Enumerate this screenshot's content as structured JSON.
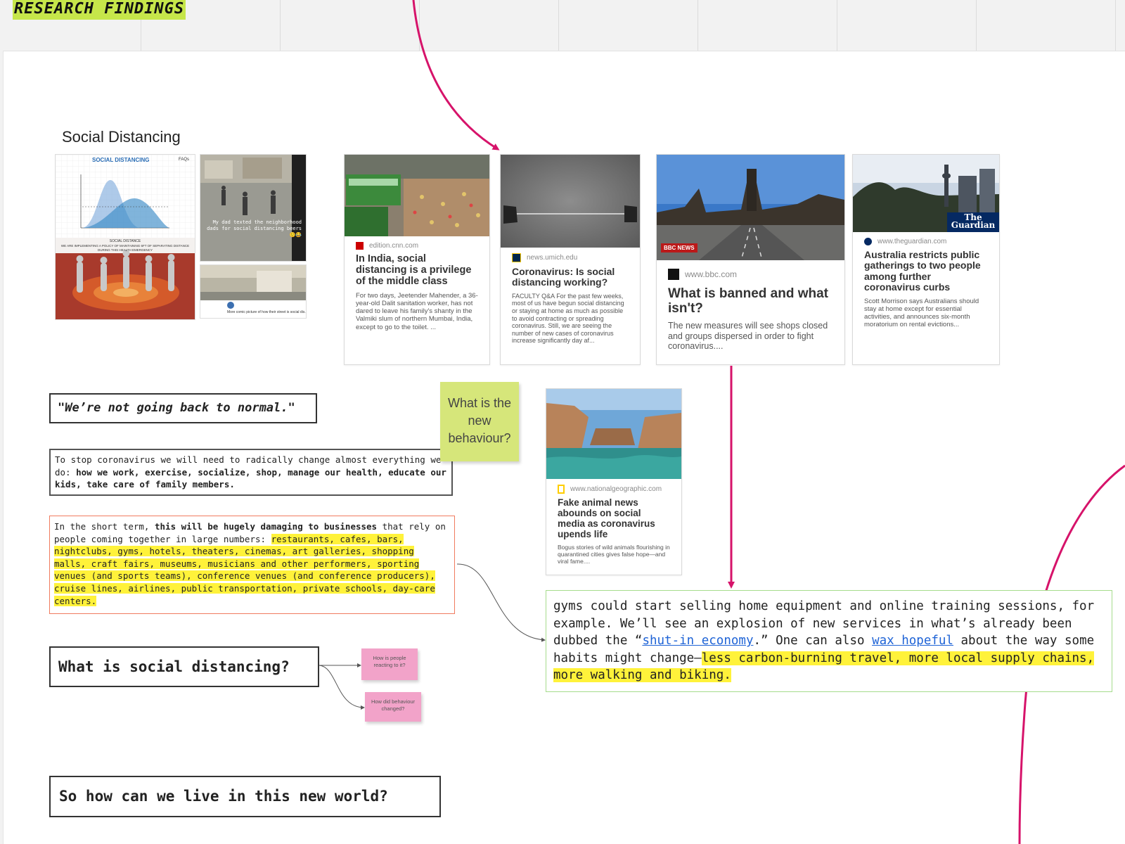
{
  "board": {
    "title": "RESEARCH FINDINGS",
    "section_title": "Social Distancing"
  },
  "thumbnails": {
    "infographic": {
      "heading": "SOCIAL DISTANCING",
      "faq": "FAQs",
      "caption_title": "SOCIAL DISTANCE",
      "caption_text": "WE ARE IMPLEMENTING A POLICY OF MAINTAINING 6FT OF SEPARATING DISTANCE DURING THIS HEALTH EMERGENCY"
    },
    "street_photo_caption": "My dad texted the neighborhood dads for social distancing beers 🙂😂",
    "tweet_caption": "More comic picture of how their street is social dis..."
  },
  "cards": {
    "cnn": {
      "domain": "edition.cnn.com",
      "title": "In India, social distancing is a privilege of the middle class",
      "desc": "For two days, Jeetender Mahender, a 36-year-old Dalit sanitation worker, has not dared to leave his family's shanty in the Valmiki slum of northern Mumbai, India, except to go to the toilet. ..."
    },
    "umich": {
      "domain": "news.umich.edu",
      "title": "Coronavirus: Is social distancing working?",
      "desc": "FACULTY Q&A  For the past few weeks, most of us have begun social distancing or staying at home as much as possible to avoid contracting or spreading coronavirus. Still, we are seeing the number of new cases of coronavirus increase significantly day af..."
    },
    "bbc": {
      "domain": "www.bbc.com",
      "badge": "BBC NEWS",
      "title": "What is banned and what isn't?",
      "desc": "The new measures will see shops closed and groups dispersed in order to fight coronavirus...."
    },
    "guardian": {
      "domain": "www.theguardian.com",
      "logo_line1": "The",
      "logo_line2": "Guardian",
      "title": "Australia restricts public gatherings to two people among further coronavirus curbs",
      "desc": "Scott Morrison says Australians should stay at home except for essential activities, and announces six-month moratorium on rental evictions..."
    },
    "natgeo": {
      "domain": "www.nationalgeographic.com",
      "title": "Fake animal news abounds on social media as coronavirus upends life",
      "desc": "Bogus stories of wild animals flourishing in quarantined cities gives false hope—and viral fame...."
    }
  },
  "notes": {
    "quote": "\"We’re not going back to normal.\"",
    "change": {
      "lead": "To stop coronavirus we will need to radically change almost everything we do: ",
      "bold": "how we work, exercise, socialize, shop, manage our health, educate our kids, take care of family members."
    },
    "damage": {
      "lead": "In the short term, ",
      "bold": "this will be hugely damaging to businesses",
      "mid": " that rely on people coming together in large numbers: ",
      "highlight": "restaurants, cafes, bars, nightclubs, gyms, hotels, theaters, cinemas, art galleries, shopping malls, craft fairs, museums, musicians and other performers, sporting venues (and sports teams), conference venues (and conference producers), cruise lines, airlines, public transportation, private schools, day-care centers."
    },
    "gyms": {
      "part1": "gyms could start selling home equipment and online training sessions, for example. We’ll see an explosion of new services in what’s already been dubbed the “",
      "link1": "shut-in economy",
      "part2": ".” One can also ",
      "link2": "wax hopeful",
      "part3": " about the way some habits might change—",
      "highlight": "less carbon-burning travel, more local supply chains, more walking and biking."
    },
    "question_social": "What is social distancing?",
    "question_live": "So how can we live in this new world?"
  },
  "stickies": {
    "new_behaviour": "What is the new behaviour?",
    "reacting": "How is people reacting to it?",
    "behaviour_changed": "How did behaviour changed?"
  },
  "colors": {
    "accent_arrow": "#d6136a",
    "title_tag": "#c6e64a",
    "highlight": "#fff23a",
    "sticky_green": "#d6e67a",
    "sticky_pink": "#f2a3c9",
    "box_red": "#f07b5f",
    "box_green": "#a6dc8c"
  }
}
